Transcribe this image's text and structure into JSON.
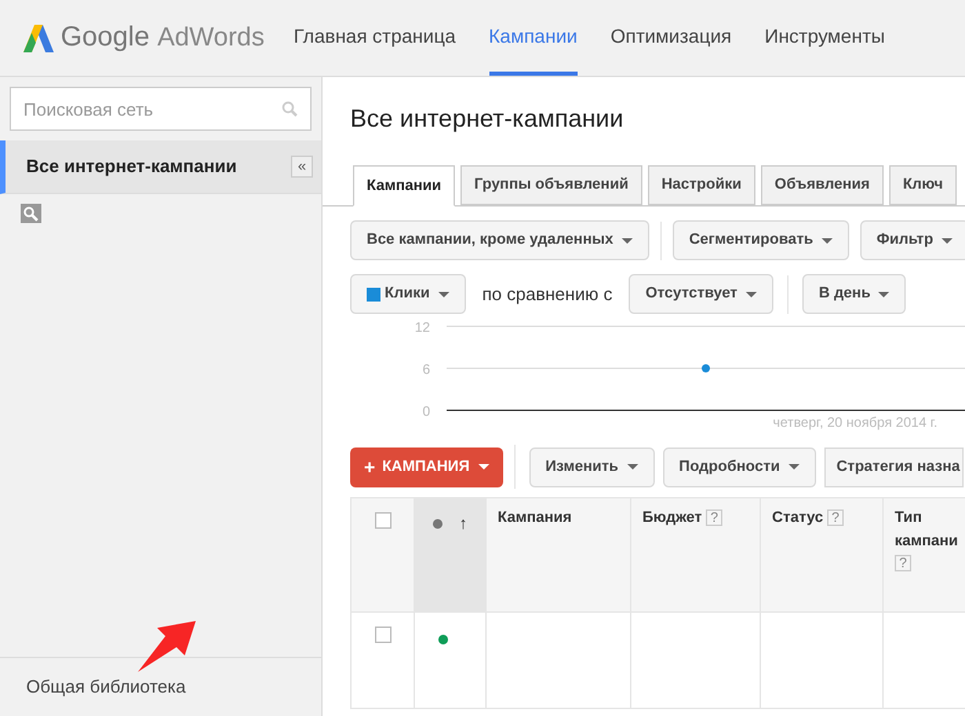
{
  "header": {
    "logo": {
      "brand": "Google",
      "product": "AdWords"
    },
    "nav": [
      {
        "label": "Главная страница",
        "selected": false
      },
      {
        "label": "Кампании",
        "selected": true
      },
      {
        "label": "Оптимизация",
        "selected": false
      },
      {
        "label": "Инструменты",
        "selected": false
      }
    ]
  },
  "sidebar": {
    "search": {
      "placeholder": "Поисковая сеть"
    },
    "items": [
      {
        "label": "Все интернет-кампании",
        "selected": true
      }
    ],
    "collapse": "«",
    "footer": "Общая библиотека"
  },
  "main": {
    "title": "Все интернет-кампании",
    "tabs": [
      {
        "label": "Кампании",
        "selected": true
      },
      {
        "label": "Группы объявлений",
        "selected": false
      },
      {
        "label": "Настройки",
        "selected": false
      },
      {
        "label": "Объявления",
        "selected": false
      },
      {
        "label": "Ключ",
        "selected": false
      }
    ],
    "filters": [
      {
        "label": "Все кампании, кроме удаленных"
      },
      {
        "label": "Сегментировать"
      },
      {
        "label": "Фильтр"
      }
    ],
    "compare": {
      "text": "по сравнению с",
      "options": [
        {
          "label": "Отсутствует"
        },
        {
          "label": "В день"
        }
      ]
    },
    "chart_data": {
      "type": "line",
      "categories": [
        "четверг, 20 ноября 2014 г."
      ],
      "series": [
        {
          "name": "Клики",
          "color": "#1a8cd8",
          "marker": true,
          "values": [
            6
          ]
        }
      ],
      "ylim": [
        0,
        12
      ],
      "yticks": [
        0,
        6,
        12
      ]
    },
    "actions": [
      {
        "kind": "primary",
        "icon": "+",
        "label": "КАМПАНИЯ"
      },
      {
        "kind": "dropdown",
        "label": "Изменить"
      },
      {
        "kind": "dropdown",
        "label": "Подробности"
      },
      {
        "kind": "cut",
        "label": "Стратегия назна"
      }
    ],
    "table": {
      "columns": [
        {
          "kind": "checkbox",
          "checked": false
        },
        {
          "kind": "status",
          "arrow": "↑"
        },
        {
          "kind": "text",
          "label": "Кампания"
        },
        {
          "kind": "text",
          "label": "Бюджет",
          "help": "?"
        },
        {
          "kind": "text",
          "label": "Статус",
          "help": "?"
        },
        {
          "kind": "text",
          "label": "Тип кампани",
          "help": "?"
        }
      ],
      "rows": [
        {
          "checked": false,
          "color": "#0f9d58"
        }
      ]
    }
  }
}
